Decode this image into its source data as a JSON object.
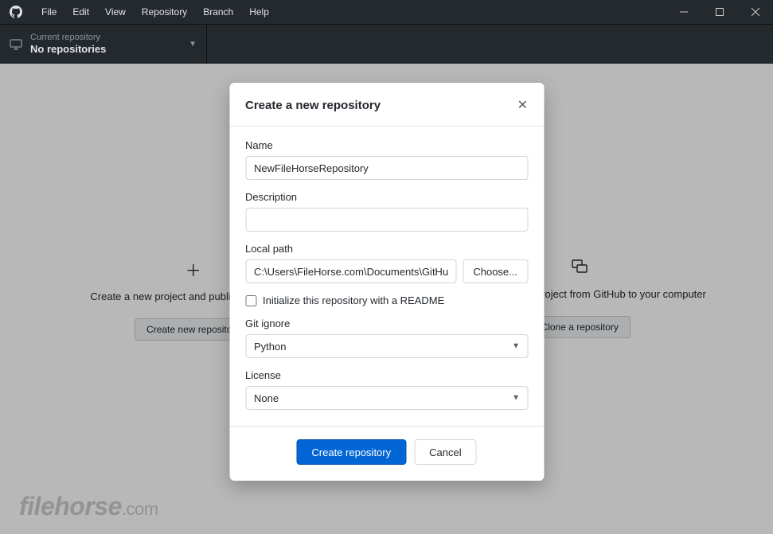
{
  "menu": {
    "items": [
      "File",
      "Edit",
      "View",
      "Repository",
      "Branch",
      "Help"
    ]
  },
  "repo_selector": {
    "label": "Current repository",
    "value": "No repositories"
  },
  "background": {
    "left": {
      "text": "Create a new project and publish it to GitHub",
      "button": "Create new repository"
    },
    "right": {
      "text": "Clone an existing project from GitHub to your computer",
      "button": "Clone a repository"
    }
  },
  "watermark": {
    "name": "filehorse",
    "tld": ".com"
  },
  "modal": {
    "title": "Create a new repository",
    "labels": {
      "name": "Name",
      "description": "Description",
      "local_path": "Local path",
      "choose": "Choose...",
      "readme": "Initialize this repository with a README",
      "gitignore": "Git ignore",
      "license": "License"
    },
    "values": {
      "name": "NewFileHorseRepository",
      "description": "",
      "local_path": "C:\\Users\\FileHorse.com\\Documents\\GitHub",
      "readme_checked": false,
      "gitignore": "Python",
      "license": "None"
    },
    "footer": {
      "primary": "Create repository",
      "cancel": "Cancel"
    }
  }
}
